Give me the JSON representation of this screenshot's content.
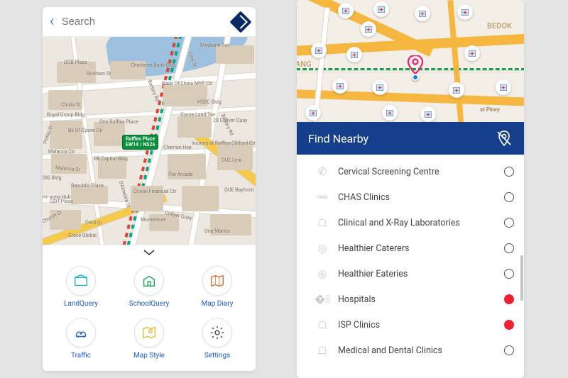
{
  "left": {
    "search_placeholder": "Search",
    "map_labels": {
      "bonham": "Bonham St",
      "uob": "UOB\nPlaza",
      "chulia": "Chulia St",
      "chartered": "Chartered\nBank Bldg",
      "maybank": "Maybank\nTwr",
      "flint": "Flint St",
      "boc": "Bank Of\nChina MYP Ctr",
      "hsbc": "HSBC\nBldg",
      "spore": "S'pore\nLand Twr",
      "collyer20": "20 Collyer\nQuay",
      "chevron": "Chevron\nHse",
      "income": "Income at\nRaffles\nClifford Ctr",
      "arcade": "The Arcade",
      "oue_link": "OUE\nLink",
      "oue_bay": "OUE\nBayfront",
      "ocean": "Ocean\nFinancial Ctr",
      "momentum": "Momentum",
      "one_marina": "One Marina",
      "collyer": "Collyer Quay",
      "battery": "Battery Rd",
      "phillip": "Phillip St",
      "malacca": "Malacca St",
      "dalmeida": "D'Almeida St",
      "cecil": "Cecil St",
      "church": "Church St",
      "royal_grp": "Royal Group\nBldg",
      "bk_spore": "Bk Of\nS'pore\nCtr",
      "one_raffles": "One\nRaffles\nPlace",
      "malacca_ctr": "Malacca\nCtr",
      "rb_capital": "RB\nCapital\nBldg",
      "republic": "Republic\nPlaza",
      "gsh": "GSH\nPlaza",
      "grace": "Grace\nGlobal",
      "msig": "MSIG\nBldg",
      "sing_hub": "Sam-\nsung\nHub"
    },
    "station": {
      "name": "Raffles Place",
      "codes": "EW14 / NS26"
    },
    "tools": [
      {
        "key": "landquery",
        "label": "LandQuery",
        "color": "#18b3c7"
      },
      {
        "key": "schoolquery",
        "label": "SchoolQuery",
        "color": "#1aa551"
      },
      {
        "key": "mapdiary",
        "label": "Map Diary",
        "color": "#e06a2b"
      },
      {
        "key": "traffic",
        "label": "Traffic",
        "color": "#2a67c9"
      },
      {
        "key": "mapstyle",
        "label": "Map Style",
        "color": "#e6b82a"
      },
      {
        "key": "settings",
        "label": "Settings",
        "color": "#444"
      }
    ]
  },
  "right": {
    "header_title": "Find Nearby",
    "area_labels": {
      "kallang_suffix": "ANG",
      "bedok": "BEDOK",
      "pkwy": "st Pkwy"
    },
    "items": [
      {
        "key": "cervical",
        "label": "Cervical Screening Centre",
        "selected": false,
        "icon": "phone"
      },
      {
        "key": "chas",
        "label": "CHAS Clinics",
        "selected": false,
        "icon": "chas"
      },
      {
        "key": "xray",
        "label": "Clinical and X-Ray Laboratories",
        "selected": false,
        "icon": "store"
      },
      {
        "key": "caterers",
        "label": "Healthier Caterers",
        "selected": false,
        "icon": "dish"
      },
      {
        "key": "eateries",
        "label": "Healthier Eateries",
        "selected": false,
        "icon": "dish"
      },
      {
        "key": "hospitals",
        "label": "Hospitals",
        "selected": true,
        "icon": "hospital"
      },
      {
        "key": "isp",
        "label": "ISP Clinics",
        "selected": true,
        "icon": "store"
      },
      {
        "key": "meddent",
        "label": "Medical and Dental Clinics",
        "selected": false,
        "icon": "store"
      }
    ]
  }
}
